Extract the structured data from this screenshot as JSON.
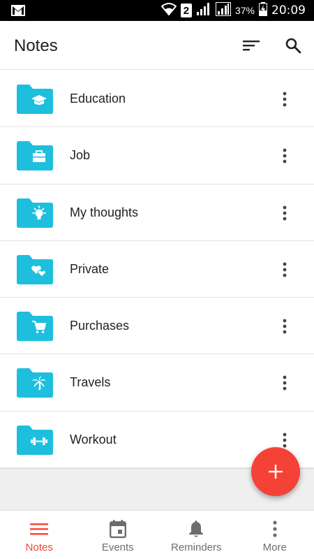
{
  "status_bar": {
    "sim": "2",
    "battery": "37%",
    "time": "20:09",
    "icons": [
      "gmail-icon",
      "wifi-icon",
      "signal-icon",
      "signal-icon",
      "battery-charging-icon"
    ]
  },
  "app_bar": {
    "title": "Notes",
    "actions": [
      "sort-icon",
      "search-icon"
    ]
  },
  "folders": [
    {
      "label": "Education",
      "icon": "graduation-cap-icon"
    },
    {
      "label": "Job",
      "icon": "briefcase-icon"
    },
    {
      "label": "My thoughts",
      "icon": "lightbulb-icon"
    },
    {
      "label": "Private",
      "icon": "hearts-icon"
    },
    {
      "label": "Purchases",
      "icon": "cart-icon"
    },
    {
      "label": "Travels",
      "icon": "palm-tree-icon"
    },
    {
      "label": "Workout",
      "icon": "dumbbell-icon"
    }
  ],
  "fab": {
    "icon": "plus-icon"
  },
  "bottom_nav": {
    "items": [
      {
        "label": "Notes",
        "icon": "notes-list-icon",
        "active": true
      },
      {
        "label": "Events",
        "icon": "calendar-icon",
        "active": false
      },
      {
        "label": "Reminders",
        "icon": "bell-icon",
        "active": false
      },
      {
        "label": "More",
        "icon": "more-vertical-icon",
        "active": false
      }
    ]
  },
  "colors": {
    "folder": "#1ebfdd",
    "accent": "#f44336",
    "text": "#222222",
    "nav_inactive": "#6d6d6d"
  }
}
